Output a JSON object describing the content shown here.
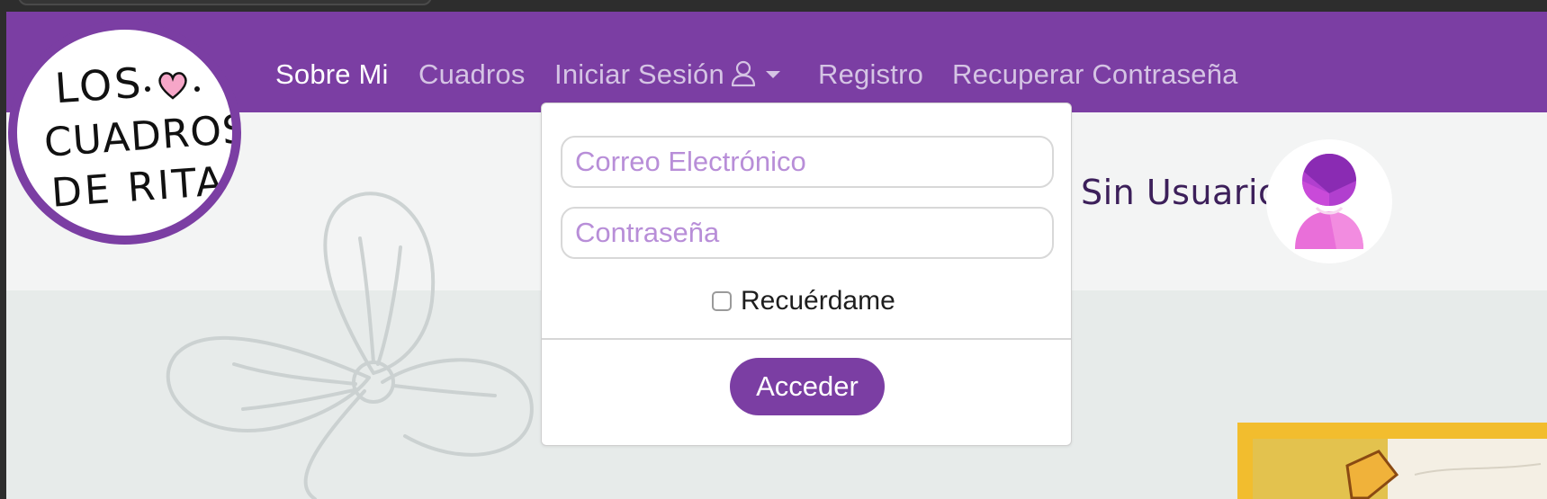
{
  "brand": {
    "logo_lines": [
      "LOS",
      "CUADROS",
      "DE RITA"
    ]
  },
  "nav": {
    "items": [
      {
        "label": "Sobre Mi"
      },
      {
        "label": "Cuadros"
      },
      {
        "label": "Iniciar Sesión"
      },
      {
        "label": "Registro"
      },
      {
        "label": "Recuperar Contraseña"
      }
    ]
  },
  "login": {
    "email_placeholder": "Correo Electrónico",
    "password_placeholder": "Contraseña",
    "remember_label": "Recuérdame",
    "remember_checked": false,
    "submit_label": "Acceder"
  },
  "user": {
    "name": "Sin Usuario",
    "avatar_icon": "user-avatar-icon"
  },
  "icons": {
    "login_icon": "user-outline-icon",
    "dropdown_icon": "caret-down-icon"
  },
  "colors": {
    "brand_purple": "#7b3ea3",
    "placeholder": "#b88ed8",
    "avatar_pink": "#e96fd9",
    "frame_yellow": "#f2bd2e"
  }
}
